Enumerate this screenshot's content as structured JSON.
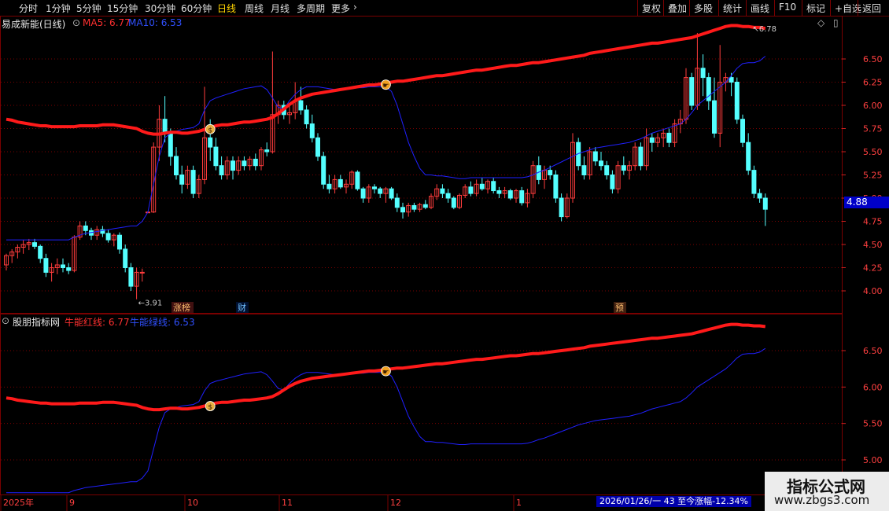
{
  "toolbar": {
    "left": [
      "分时",
      "1分钟",
      "5分钟",
      "15分钟",
      "30分钟",
      "60分钟",
      "日线",
      "周线",
      "月线",
      "多周期",
      "更多"
    ],
    "active": "日线",
    "more_icon": "chevron-right-icon",
    "right": [
      "复权",
      "叠加",
      "多股",
      "统计",
      "画线",
      "F10",
      "标记",
      "+自选",
      "返回"
    ]
  },
  "main_panel": {
    "title": "易成新能(日线)",
    "ma5_label": "MA5: 6.77",
    "ma10_label": "MA10: 6.53",
    "last_price": "4.88",
    "high_annotation": "6.78",
    "low_annotation": "3.91",
    "event_tags": [
      "涨榜",
      "财",
      "预"
    ]
  },
  "sub_panel": {
    "title": "股朋指标网",
    "red_label": "牛能红线: 6.77",
    "blue_label": "牛能绿线: 6.53"
  },
  "time_axis": {
    "labels": [
      "2025年",
      "9",
      "10",
      "11",
      "12",
      "1"
    ],
    "date_info": "2026/01/26/一 43 至今涨幅-12.34%"
  },
  "watermark": {
    "line1": "指标公式网",
    "line2": "www.zbgs3.com"
  },
  "colors": {
    "up": "#ff3c3c",
    "down": "#54ffff",
    "red_line": "#ff1a1a",
    "blue_line": "#2020ff",
    "grid": "#7a0000"
  },
  "chart_data": [
    {
      "type": "candlestick",
      "ylim": [
        3.85,
        6.95
      ],
      "yticks": [
        4.0,
        4.25,
        4.5,
        4.75,
        5.0,
        5.25,
        5.5,
        5.75,
        6.0,
        6.25,
        6.5
      ],
      "ohlc": [
        [
          4.28,
          4.4,
          4.22,
          4.38
        ],
        [
          4.38,
          4.45,
          4.3,
          4.42
        ],
        [
          4.42,
          4.5,
          4.35,
          4.47
        ],
        [
          4.47,
          4.55,
          4.4,
          4.5
        ],
        [
          4.5,
          4.56,
          4.44,
          4.52
        ],
        [
          4.52,
          4.56,
          4.45,
          4.48
        ],
        [
          4.48,
          4.5,
          4.3,
          4.35
        ],
        [
          4.35,
          4.4,
          4.15,
          4.2
        ],
        [
          4.2,
          4.3,
          4.1,
          4.25
        ],
        [
          4.25,
          4.35,
          4.18,
          4.28
        ],
        [
          4.28,
          4.35,
          4.2,
          4.25
        ],
        [
          4.25,
          4.3,
          4.18,
          4.22
        ],
        [
          4.22,
          4.6,
          4.2,
          4.58
        ],
        [
          4.58,
          4.75,
          4.55,
          4.7
        ],
        [
          4.7,
          4.75,
          4.6,
          4.65
        ],
        [
          4.65,
          4.68,
          4.55,
          4.6
        ],
        [
          4.6,
          4.7,
          4.55,
          4.66
        ],
        [
          4.66,
          4.7,
          4.58,
          4.62
        ],
        [
          4.62,
          4.66,
          4.52,
          4.55
        ],
        [
          4.55,
          4.62,
          4.48,
          4.6
        ],
        [
          4.6,
          4.63,
          4.4,
          4.45
        ],
        [
          4.45,
          4.5,
          4.2,
          4.25
        ],
        [
          4.25,
          4.3,
          4.0,
          4.05
        ],
        [
          4.05,
          4.25,
          3.91,
          4.2
        ],
        [
          4.2,
          4.24,
          4.1,
          4.2
        ],
        [
          4.85,
          4.85,
          4.85,
          4.85
        ],
        [
          4.85,
          5.6,
          4.84,
          5.55
        ],
        [
          5.55,
          6.0,
          5.4,
          5.85
        ],
        [
          5.85,
          6.1,
          5.6,
          5.7
        ],
        [
          5.7,
          5.75,
          5.35,
          5.45
        ],
        [
          5.45,
          5.55,
          5.2,
          5.25
        ],
        [
          5.25,
          5.35,
          5.05,
          5.15
        ],
        [
          5.15,
          5.35,
          5.1,
          5.3
        ],
        [
          5.3,
          5.35,
          5.0,
          5.05
        ],
        [
          5.05,
          5.25,
          5.0,
          5.2
        ],
        [
          5.2,
          6.2,
          5.15,
          5.65
        ],
        [
          5.65,
          5.85,
          5.4,
          5.55
        ],
        [
          5.55,
          5.65,
          5.3,
          5.35
        ],
        [
          5.35,
          5.45,
          5.2,
          5.25
        ],
        [
          5.25,
          5.45,
          5.2,
          5.4
        ],
        [
          5.4,
          5.45,
          5.2,
          5.3
        ],
        [
          5.3,
          5.45,
          5.25,
          5.4
        ],
        [
          5.4,
          5.45,
          5.3,
          5.35
        ],
        [
          5.35,
          5.45,
          5.3,
          5.42
        ],
        [
          5.42,
          5.48,
          5.3,
          5.35
        ],
        [
          5.35,
          5.55,
          5.3,
          5.52
        ],
        [
          5.52,
          5.6,
          5.45,
          5.5
        ],
        [
          5.5,
          6.58,
          5.48,
          5.9
        ],
        [
          5.9,
          6.05,
          5.8,
          6.0
        ],
        [
          6.0,
          6.05,
          5.85,
          5.9
        ],
        [
          5.9,
          6.0,
          5.8,
          5.92
        ],
        [
          5.92,
          6.25,
          5.85,
          6.05
        ],
        [
          6.05,
          6.2,
          5.9,
          5.95
        ],
        [
          5.95,
          6.0,
          5.75,
          5.8
        ],
        [
          5.8,
          5.9,
          5.6,
          5.65
        ],
        [
          5.65,
          5.7,
          5.4,
          5.45
        ],
        [
          5.45,
          5.5,
          5.1,
          5.15
        ],
        [
          5.15,
          5.25,
          5.05,
          5.1
        ],
        [
          5.1,
          5.25,
          5.05,
          5.2
        ],
        [
          5.2,
          5.25,
          5.1,
          5.12
        ],
        [
          5.12,
          5.2,
          5.05,
          5.15
        ],
        [
          5.15,
          5.3,
          5.1,
          5.28
        ],
        [
          5.28,
          5.3,
          5.08,
          5.1
        ],
        [
          5.1,
          5.12,
          4.95,
          5.0
        ],
        [
          5.0,
          5.15,
          4.95,
          5.12
        ],
        [
          5.12,
          5.15,
          5.05,
          5.1
        ],
        [
          5.1,
          5.12,
          5.0,
          5.05
        ],
        [
          5.05,
          5.12,
          4.95,
          5.1
        ],
        [
          5.1,
          5.12,
          4.98,
          5.0
        ],
        [
          5.0,
          5.05,
          4.85,
          4.9
        ],
        [
          4.9,
          4.95,
          4.78,
          4.85
        ],
        [
          4.85,
          4.95,
          4.8,
          4.92
        ],
        [
          4.92,
          4.95,
          4.85,
          4.88
        ],
        [
          4.88,
          4.95,
          4.85,
          4.93
        ],
        [
          4.93,
          4.98,
          4.88,
          4.9
        ],
        [
          4.9,
          5.05,
          4.88,
          5.02
        ],
        [
          5.02,
          5.15,
          4.98,
          5.1
        ],
        [
          5.1,
          5.15,
          5.0,
          5.05
        ],
        [
          5.05,
          5.1,
          4.95,
          5.0
        ],
        [
          5.0,
          5.02,
          4.88,
          4.9
        ],
        [
          4.9,
          5.05,
          4.88,
          5.03
        ],
        [
          5.03,
          5.15,
          5.0,
          5.12
        ],
        [
          5.12,
          5.18,
          5.02,
          5.05
        ],
        [
          5.05,
          5.2,
          5.02,
          5.15
        ],
        [
          5.15,
          5.22,
          5.08,
          5.1
        ],
        [
          5.1,
          5.2,
          5.05,
          5.18
        ],
        [
          5.18,
          5.22,
          5.05,
          5.08
        ],
        [
          5.08,
          5.12,
          5.0,
          5.05
        ],
        [
          5.05,
          5.12,
          5.0,
          5.08
        ],
        [
          5.08,
          5.1,
          4.98,
          5.0
        ],
        [
          5.0,
          5.1,
          4.95,
          5.08
        ],
        [
          5.08,
          5.12,
          4.92,
          4.95
        ],
        [
          4.95,
          5.1,
          4.9,
          5.05
        ],
        [
          5.05,
          5.4,
          5.0,
          5.35
        ],
        [
          5.35,
          5.45,
          5.15,
          5.2
        ],
        [
          5.2,
          5.35,
          5.1,
          5.3
        ],
        [
          5.3,
          5.35,
          5.2,
          5.25
        ],
        [
          5.25,
          5.3,
          4.95,
          5.0
        ],
        [
          5.0,
          5.05,
          4.75,
          4.8
        ],
        [
          4.8,
          5.05,
          4.78,
          5.0
        ],
        [
          5.0,
          5.7,
          4.95,
          5.6
        ],
        [
          5.6,
          5.65,
          5.3,
          5.35
        ],
        [
          5.35,
          5.45,
          5.2,
          5.25
        ],
        [
          5.25,
          5.55,
          5.2,
          5.5
        ],
        [
          5.5,
          5.55,
          5.35,
          5.4
        ],
        [
          5.4,
          5.5,
          5.3,
          5.35
        ],
        [
          5.35,
          5.4,
          5.2,
          5.25
        ],
        [
          5.25,
          5.3,
          5.05,
          5.1
        ],
        [
          5.1,
          5.4,
          5.05,
          5.35
        ],
        [
          5.35,
          5.45,
          5.25,
          5.3
        ],
        [
          5.3,
          5.4,
          5.2,
          5.35
        ],
        [
          5.35,
          5.6,
          5.3,
          5.55
        ],
        [
          5.55,
          5.6,
          5.3,
          5.35
        ],
        [
          5.35,
          5.75,
          5.3,
          5.65
        ],
        [
          5.65,
          5.7,
          5.5,
          5.6
        ],
        [
          5.6,
          5.7,
          5.55,
          5.65
        ],
        [
          5.65,
          5.75,
          5.55,
          5.7
        ],
        [
          5.7,
          5.75,
          5.55,
          5.6
        ],
        [
          5.6,
          5.85,
          5.55,
          5.8
        ],
        [
          5.8,
          5.95,
          5.7,
          5.85
        ],
        [
          5.85,
          6.4,
          5.8,
          6.3
        ],
        [
          6.3,
          6.35,
          5.95,
          6.0
        ],
        [
          6.0,
          6.78,
          5.95,
          6.4
        ],
        [
          6.4,
          6.55,
          6.1,
          6.3
        ],
        [
          6.3,
          6.35,
          5.95,
          6.05
        ],
        [
          6.05,
          6.3,
          5.65,
          5.7
        ],
        [
          5.7,
          6.65,
          5.55,
          6.25
        ],
        [
          6.25,
          6.35,
          6.15,
          6.3
        ],
        [
          6.3,
          6.35,
          6.1,
          6.25
        ],
        [
          6.25,
          6.3,
          5.8,
          5.85
        ],
        [
          5.85,
          5.9,
          5.55,
          5.6
        ],
        [
          5.6,
          5.7,
          5.25,
          5.3
        ],
        [
          5.3,
          5.35,
          5.0,
          5.05
        ],
        [
          5.05,
          5.1,
          4.95,
          5.0
        ],
        [
          5.0,
          5.05,
          4.7,
          4.88
        ]
      ],
      "ma_red": [
        5.85,
        5.84,
        5.82,
        5.81,
        5.8,
        5.79,
        5.78,
        5.78,
        5.77,
        5.77,
        5.77,
        5.77,
        5.77,
        5.78,
        5.78,
        5.78,
        5.78,
        5.79,
        5.79,
        5.79,
        5.78,
        5.77,
        5.76,
        5.75,
        5.72,
        5.7,
        5.69,
        5.69,
        5.7,
        5.71,
        5.71,
        5.7,
        5.7,
        5.71,
        5.72,
        5.74,
        5.76,
        5.78,
        5.79,
        5.79,
        5.8,
        5.81,
        5.82,
        5.82,
        5.83,
        5.84,
        5.85,
        5.87,
        5.91,
        5.96,
        6.01,
        6.05,
        6.08,
        6.1,
        6.12,
        6.13,
        6.14,
        6.15,
        6.16,
        6.17,
        6.18,
        6.19,
        6.2,
        6.21,
        6.22,
        6.22,
        6.23,
        6.24,
        6.25,
        6.26,
        6.26,
        6.27,
        6.28,
        6.29,
        6.3,
        6.31,
        6.32,
        6.32,
        6.33,
        6.34,
        6.35,
        6.36,
        6.37,
        6.38,
        6.38,
        6.39,
        6.4,
        6.41,
        6.42,
        6.43,
        6.43,
        6.44,
        6.45,
        6.46,
        6.46,
        6.47,
        6.48,
        6.49,
        6.5,
        6.51,
        6.52,
        6.53,
        6.54,
        6.56,
        6.57,
        6.58,
        6.59,
        6.6,
        6.61,
        6.62,
        6.63,
        6.64,
        6.65,
        6.66,
        6.67,
        6.67,
        6.68,
        6.69,
        6.7,
        6.71,
        6.72,
        6.73,
        6.75,
        6.77,
        6.79,
        6.81,
        6.83,
        6.85,
        6.86,
        6.86,
        6.85,
        6.85,
        6.84,
        6.84,
        6.83
      ],
      "ma_blue": [
        4.55,
        4.55,
        4.55,
        4.55,
        4.55,
        4.55,
        4.55,
        4.55,
        4.55,
        4.55,
        4.55,
        4.55,
        4.58,
        4.6,
        4.62,
        4.63,
        4.64,
        4.65,
        4.66,
        4.67,
        4.68,
        4.69,
        4.7,
        4.7,
        4.75,
        4.85,
        5.15,
        5.45,
        5.65,
        5.7,
        5.72,
        5.74,
        5.75,
        5.76,
        5.8,
        5.95,
        6.05,
        6.08,
        6.1,
        6.12,
        6.14,
        6.16,
        6.18,
        6.19,
        6.2,
        6.21,
        6.17,
        6.08,
        5.98,
        5.96,
        6.05,
        6.12,
        6.17,
        6.2,
        6.2,
        6.2,
        6.19,
        6.18,
        6.17,
        6.17,
        6.18,
        6.18,
        6.19,
        6.19,
        6.2,
        6.2,
        6.2,
        6.2,
        6.15,
        6.0,
        5.8,
        5.6,
        5.45,
        5.32,
        5.25,
        5.25,
        5.24,
        5.24,
        5.23,
        5.22,
        5.21,
        5.21,
        5.22,
        5.22,
        5.22,
        5.22,
        5.22,
        5.22,
        5.22,
        5.22,
        5.22,
        5.22,
        5.23,
        5.25,
        5.28,
        5.3,
        5.33,
        5.36,
        5.39,
        5.42,
        5.45,
        5.48,
        5.5,
        5.52,
        5.54,
        5.55,
        5.56,
        5.57,
        5.58,
        5.59,
        5.6,
        5.62,
        5.64,
        5.67,
        5.7,
        5.72,
        5.74,
        5.76,
        5.78,
        5.8,
        5.85,
        5.92,
        6.0,
        6.05,
        6.1,
        6.15,
        6.2,
        6.25,
        6.32,
        6.4,
        6.45,
        6.46,
        6.46,
        6.48,
        6.53
      ]
    },
    {
      "type": "line",
      "ylim": [
        4.85,
        6.95
      ],
      "yticks": [
        5.0,
        5.5,
        6.0,
        6.5
      ],
      "series": [
        "ma_red",
        "ma_blue"
      ]
    }
  ]
}
